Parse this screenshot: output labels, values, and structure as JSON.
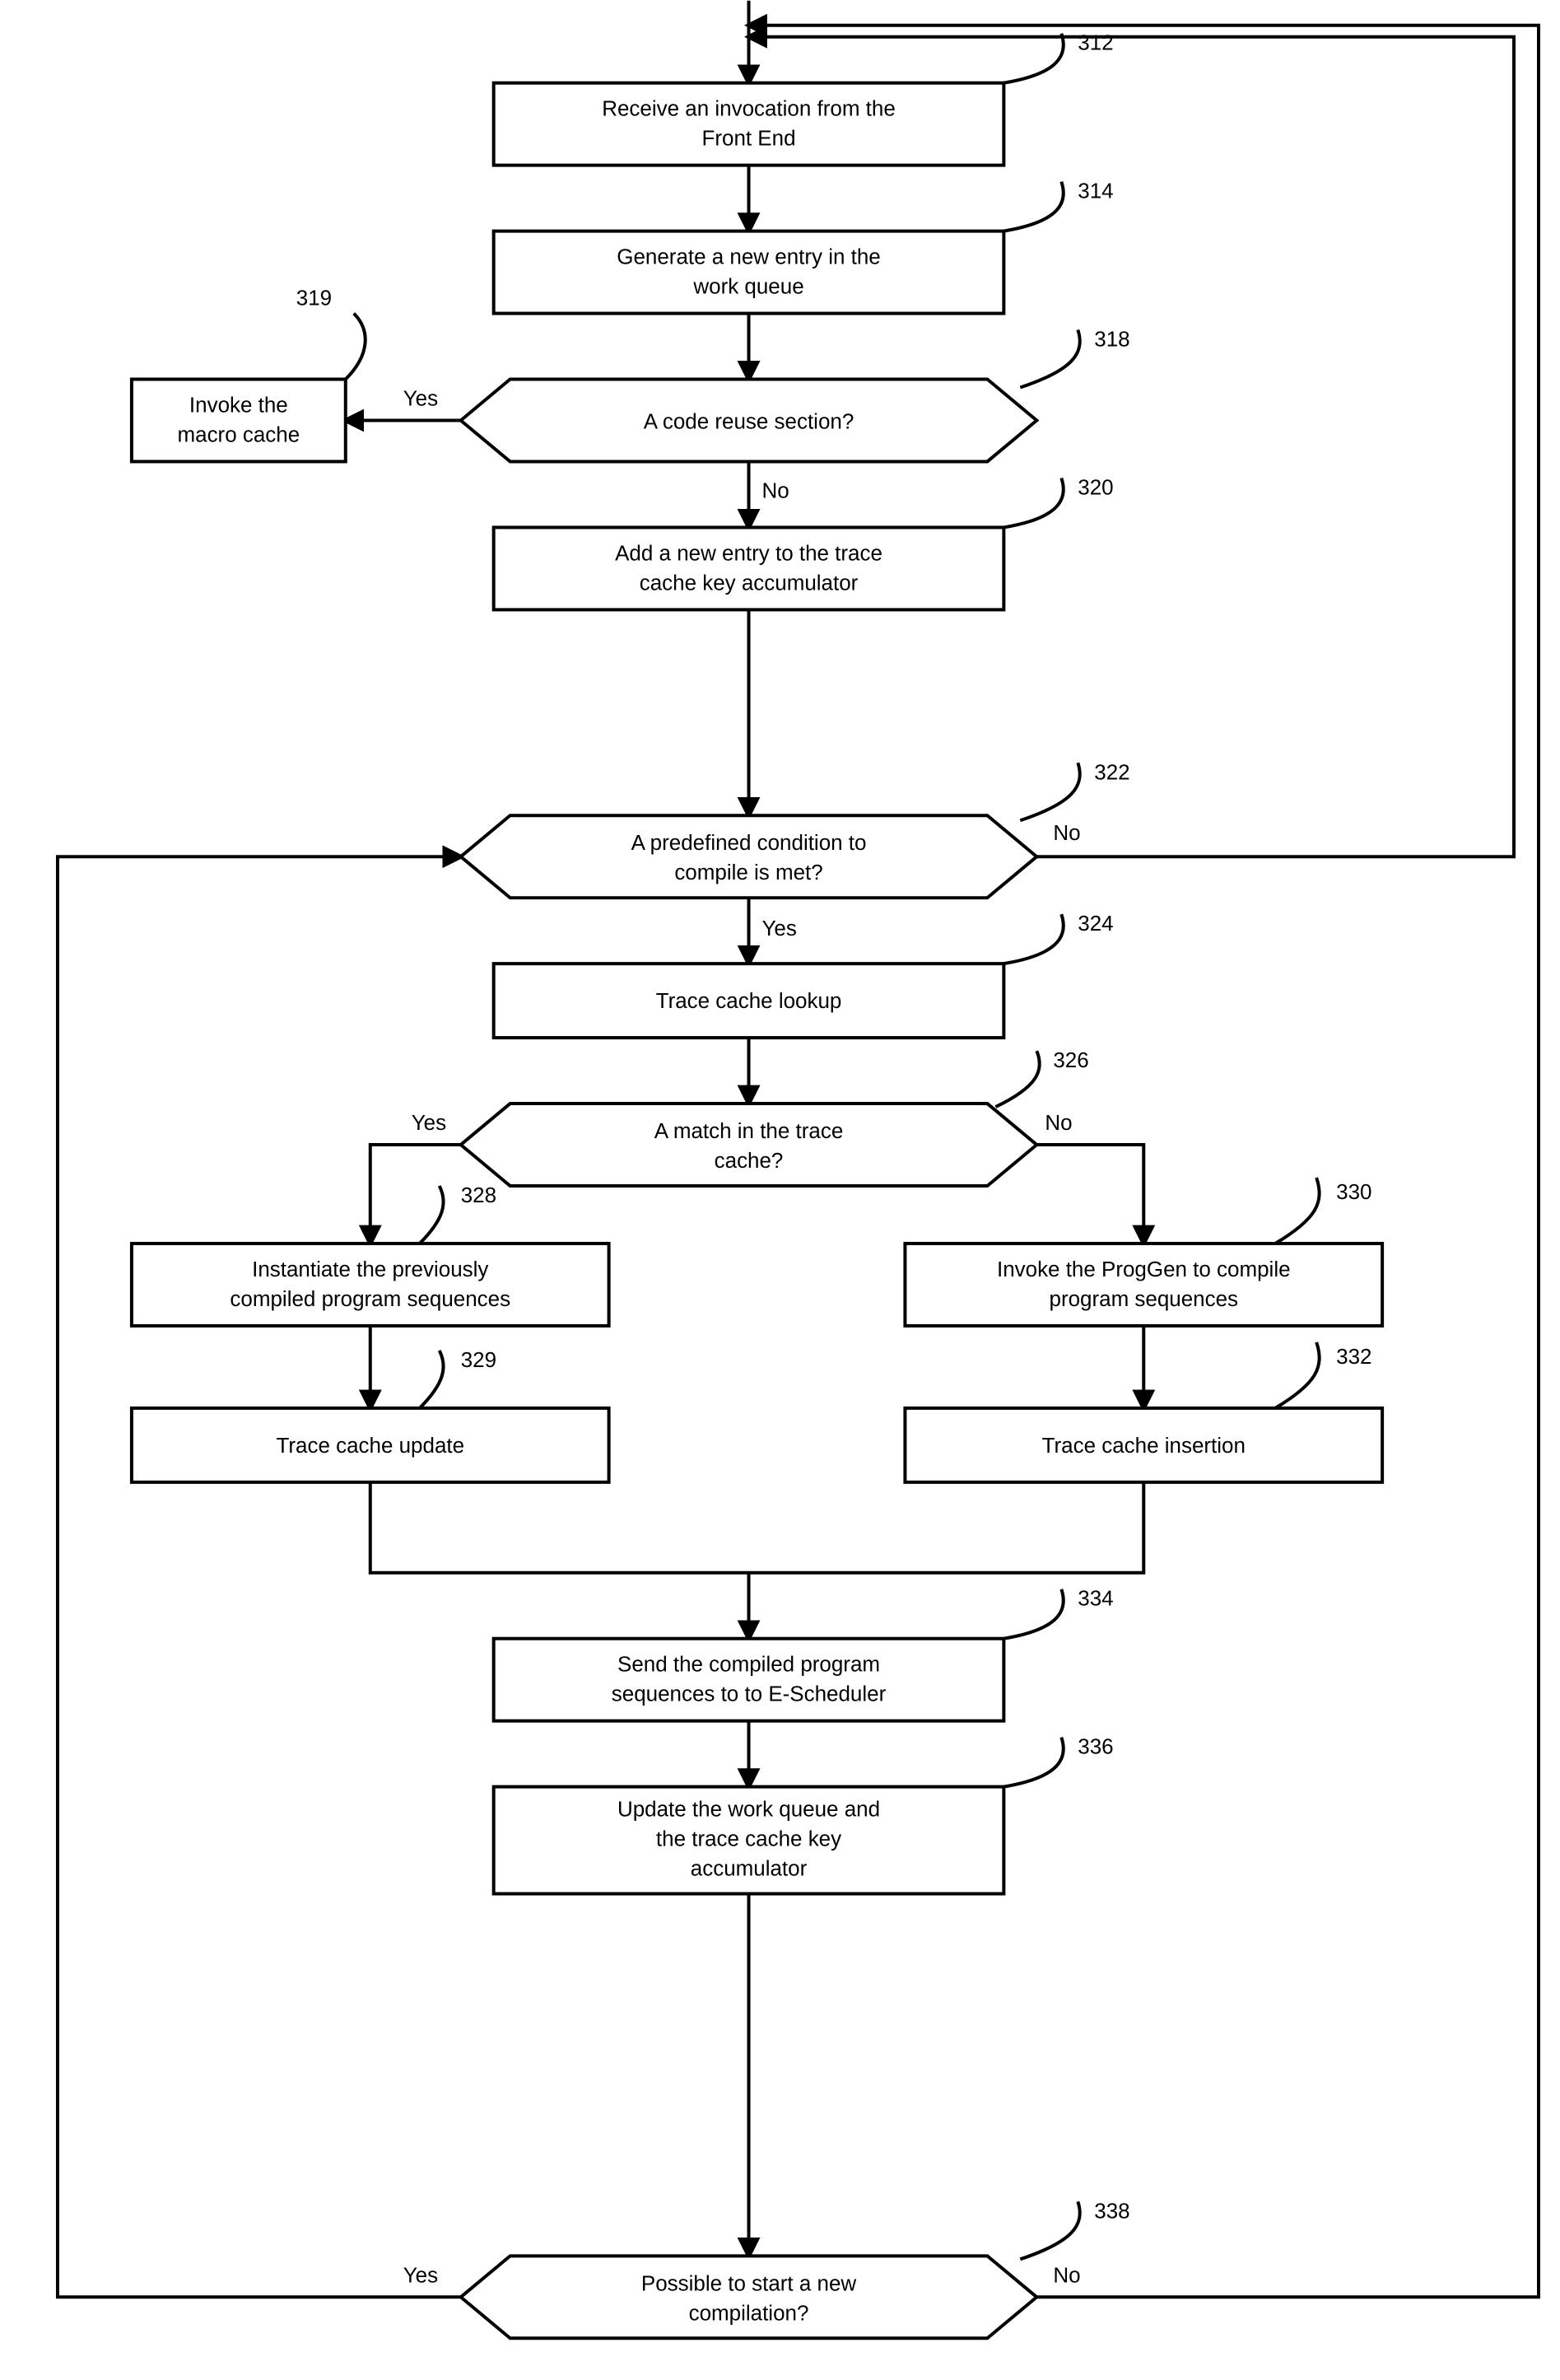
{
  "nodes": {
    "n319": {
      "ref": "319",
      "lines": [
        "Invoke the",
        "macro cache"
      ]
    },
    "n312": {
      "ref": "312",
      "lines": [
        "Receive an invocation from the",
        "Front End"
      ]
    },
    "n314": {
      "ref": "314",
      "lines": [
        "Generate a new entry in the",
        "work queue"
      ]
    },
    "n318": {
      "ref": "318",
      "lines": [
        "A code reuse section?"
      ]
    },
    "n320": {
      "ref": "320",
      "lines": [
        "Add a new entry to the trace",
        "cache key accumulator"
      ]
    },
    "n322": {
      "ref": "322",
      "lines": [
        "A predefined condition to",
        "compile is met?"
      ]
    },
    "n324": {
      "ref": "324",
      "lines": [
        "Trace cache lookup"
      ]
    },
    "n326": {
      "ref": "326",
      "lines": [
        "A match in the trace",
        "cache?"
      ]
    },
    "n328": {
      "ref": "328",
      "lines": [
        "Instantiate the previously",
        "compiled program sequences"
      ]
    },
    "n329": {
      "ref": "329",
      "lines": [
        "Trace cache update"
      ]
    },
    "n330": {
      "ref": "330",
      "lines": [
        "Invoke the ProgGen to compile",
        "program sequences"
      ]
    },
    "n332": {
      "ref": "332",
      "lines": [
        "Trace cache insertion"
      ]
    },
    "n334": {
      "ref": "334",
      "lines": [
        "Send the compiled program",
        "sequences to to E-Scheduler"
      ]
    },
    "n336": {
      "ref": "336",
      "lines": [
        "Update the work queue and",
        "the trace cache key",
        "accumulator"
      ]
    },
    "n338": {
      "ref": "338",
      "lines": [
        "Possible to start a new",
        "compilation?"
      ]
    }
  },
  "edgeLabels": {
    "yes": "Yes",
    "no": "No"
  }
}
